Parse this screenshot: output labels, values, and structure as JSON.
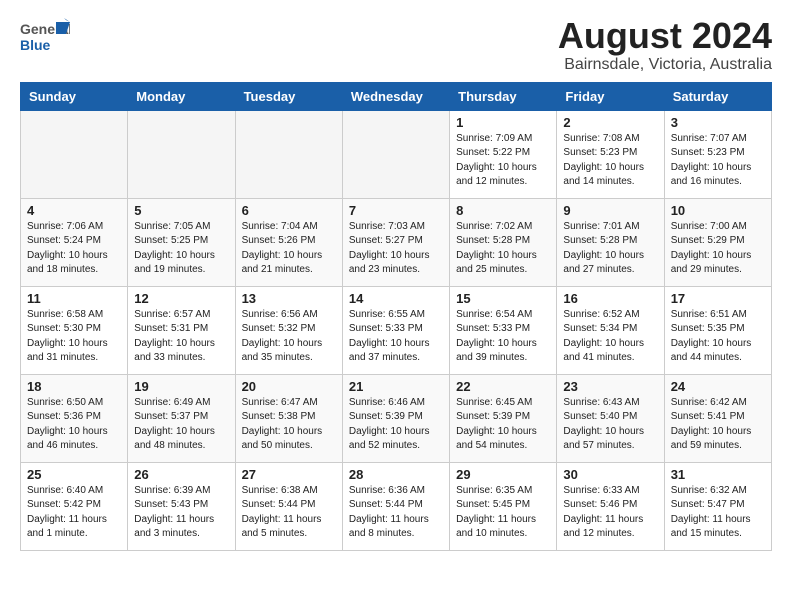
{
  "header": {
    "logo_general": "General",
    "logo_blue": "Blue",
    "month_title": "August 2024",
    "location": "Bairnsdale, Victoria, Australia"
  },
  "weekdays": [
    "Sunday",
    "Monday",
    "Tuesday",
    "Wednesday",
    "Thursday",
    "Friday",
    "Saturday"
  ],
  "weeks": [
    [
      {
        "day": "",
        "empty": true
      },
      {
        "day": "",
        "empty": true
      },
      {
        "day": "",
        "empty": true
      },
      {
        "day": "",
        "empty": true
      },
      {
        "day": "1",
        "sunrise": "7:09 AM",
        "sunset": "5:22 PM",
        "daylight": "10 hours and 12 minutes."
      },
      {
        "day": "2",
        "sunrise": "7:08 AM",
        "sunset": "5:23 PM",
        "daylight": "10 hours and 14 minutes."
      },
      {
        "day": "3",
        "sunrise": "7:07 AM",
        "sunset": "5:23 PM",
        "daylight": "10 hours and 16 minutes."
      }
    ],
    [
      {
        "day": "4",
        "sunrise": "7:06 AM",
        "sunset": "5:24 PM",
        "daylight": "10 hours and 18 minutes."
      },
      {
        "day": "5",
        "sunrise": "7:05 AM",
        "sunset": "5:25 PM",
        "daylight": "10 hours and 19 minutes."
      },
      {
        "day": "6",
        "sunrise": "7:04 AM",
        "sunset": "5:26 PM",
        "daylight": "10 hours and 21 minutes."
      },
      {
        "day": "7",
        "sunrise": "7:03 AM",
        "sunset": "5:27 PM",
        "daylight": "10 hours and 23 minutes."
      },
      {
        "day": "8",
        "sunrise": "7:02 AM",
        "sunset": "5:28 PM",
        "daylight": "10 hours and 25 minutes."
      },
      {
        "day": "9",
        "sunrise": "7:01 AM",
        "sunset": "5:28 PM",
        "daylight": "10 hours and 27 minutes."
      },
      {
        "day": "10",
        "sunrise": "7:00 AM",
        "sunset": "5:29 PM",
        "daylight": "10 hours and 29 minutes."
      }
    ],
    [
      {
        "day": "11",
        "sunrise": "6:58 AM",
        "sunset": "5:30 PM",
        "daylight": "10 hours and 31 minutes."
      },
      {
        "day": "12",
        "sunrise": "6:57 AM",
        "sunset": "5:31 PM",
        "daylight": "10 hours and 33 minutes."
      },
      {
        "day": "13",
        "sunrise": "6:56 AM",
        "sunset": "5:32 PM",
        "daylight": "10 hours and 35 minutes."
      },
      {
        "day": "14",
        "sunrise": "6:55 AM",
        "sunset": "5:33 PM",
        "daylight": "10 hours and 37 minutes."
      },
      {
        "day": "15",
        "sunrise": "6:54 AM",
        "sunset": "5:33 PM",
        "daylight": "10 hours and 39 minutes."
      },
      {
        "day": "16",
        "sunrise": "6:52 AM",
        "sunset": "5:34 PM",
        "daylight": "10 hours and 41 minutes."
      },
      {
        "day": "17",
        "sunrise": "6:51 AM",
        "sunset": "5:35 PM",
        "daylight": "10 hours and 44 minutes."
      }
    ],
    [
      {
        "day": "18",
        "sunrise": "6:50 AM",
        "sunset": "5:36 PM",
        "daylight": "10 hours and 46 minutes."
      },
      {
        "day": "19",
        "sunrise": "6:49 AM",
        "sunset": "5:37 PM",
        "daylight": "10 hours and 48 minutes."
      },
      {
        "day": "20",
        "sunrise": "6:47 AM",
        "sunset": "5:38 PM",
        "daylight": "10 hours and 50 minutes."
      },
      {
        "day": "21",
        "sunrise": "6:46 AM",
        "sunset": "5:39 PM",
        "daylight": "10 hours and 52 minutes."
      },
      {
        "day": "22",
        "sunrise": "6:45 AM",
        "sunset": "5:39 PM",
        "daylight": "10 hours and 54 minutes."
      },
      {
        "day": "23",
        "sunrise": "6:43 AM",
        "sunset": "5:40 PM",
        "daylight": "10 hours and 57 minutes."
      },
      {
        "day": "24",
        "sunrise": "6:42 AM",
        "sunset": "5:41 PM",
        "daylight": "10 hours and 59 minutes."
      }
    ],
    [
      {
        "day": "25",
        "sunrise": "6:40 AM",
        "sunset": "5:42 PM",
        "daylight": "11 hours and 1 minute."
      },
      {
        "day": "26",
        "sunrise": "6:39 AM",
        "sunset": "5:43 PM",
        "daylight": "11 hours and 3 minutes."
      },
      {
        "day": "27",
        "sunrise": "6:38 AM",
        "sunset": "5:44 PM",
        "daylight": "11 hours and 5 minutes."
      },
      {
        "day": "28",
        "sunrise": "6:36 AM",
        "sunset": "5:44 PM",
        "daylight": "11 hours and 8 minutes."
      },
      {
        "day": "29",
        "sunrise": "6:35 AM",
        "sunset": "5:45 PM",
        "daylight": "11 hours and 10 minutes."
      },
      {
        "day": "30",
        "sunrise": "6:33 AM",
        "sunset": "5:46 PM",
        "daylight": "11 hours and 12 minutes."
      },
      {
        "day": "31",
        "sunrise": "6:32 AM",
        "sunset": "5:47 PM",
        "daylight": "11 hours and 15 minutes."
      }
    ]
  ],
  "labels": {
    "sunrise": "Sunrise:",
    "sunset": "Sunset:",
    "daylight": "Daylight:"
  }
}
